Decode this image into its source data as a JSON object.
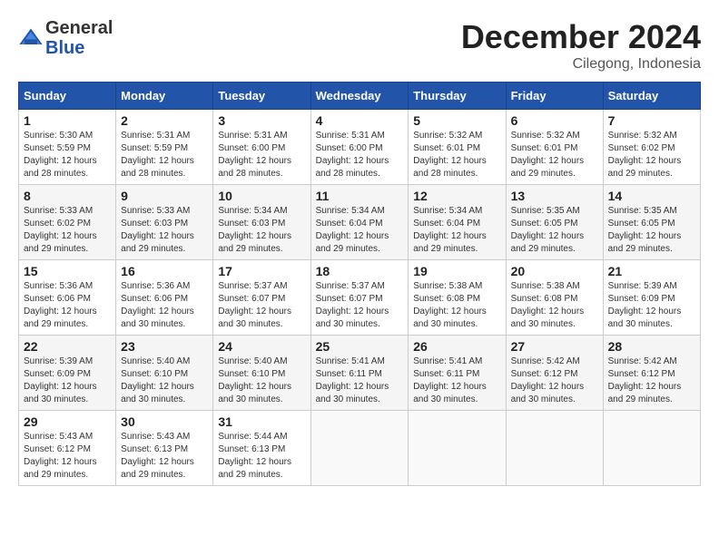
{
  "header": {
    "logo_line1": "General",
    "logo_line2": "Blue",
    "month": "December 2024",
    "location": "Cilegong, Indonesia"
  },
  "days_of_week": [
    "Sunday",
    "Monday",
    "Tuesday",
    "Wednesday",
    "Thursday",
    "Friday",
    "Saturday"
  ],
  "weeks": [
    [
      {
        "day": "1",
        "info": "Sunrise: 5:30 AM\nSunset: 5:59 PM\nDaylight: 12 hours\nand 28 minutes."
      },
      {
        "day": "2",
        "info": "Sunrise: 5:31 AM\nSunset: 5:59 PM\nDaylight: 12 hours\nand 28 minutes."
      },
      {
        "day": "3",
        "info": "Sunrise: 5:31 AM\nSunset: 6:00 PM\nDaylight: 12 hours\nand 28 minutes."
      },
      {
        "day": "4",
        "info": "Sunrise: 5:31 AM\nSunset: 6:00 PM\nDaylight: 12 hours\nand 28 minutes."
      },
      {
        "day": "5",
        "info": "Sunrise: 5:32 AM\nSunset: 6:01 PM\nDaylight: 12 hours\nand 28 minutes."
      },
      {
        "day": "6",
        "info": "Sunrise: 5:32 AM\nSunset: 6:01 PM\nDaylight: 12 hours\nand 29 minutes."
      },
      {
        "day": "7",
        "info": "Sunrise: 5:32 AM\nSunset: 6:02 PM\nDaylight: 12 hours\nand 29 minutes."
      }
    ],
    [
      {
        "day": "8",
        "info": "Sunrise: 5:33 AM\nSunset: 6:02 PM\nDaylight: 12 hours\nand 29 minutes."
      },
      {
        "day": "9",
        "info": "Sunrise: 5:33 AM\nSunset: 6:03 PM\nDaylight: 12 hours\nand 29 minutes."
      },
      {
        "day": "10",
        "info": "Sunrise: 5:34 AM\nSunset: 6:03 PM\nDaylight: 12 hours\nand 29 minutes."
      },
      {
        "day": "11",
        "info": "Sunrise: 5:34 AM\nSunset: 6:04 PM\nDaylight: 12 hours\nand 29 minutes."
      },
      {
        "day": "12",
        "info": "Sunrise: 5:34 AM\nSunset: 6:04 PM\nDaylight: 12 hours\nand 29 minutes."
      },
      {
        "day": "13",
        "info": "Sunrise: 5:35 AM\nSunset: 6:05 PM\nDaylight: 12 hours\nand 29 minutes."
      },
      {
        "day": "14",
        "info": "Sunrise: 5:35 AM\nSunset: 6:05 PM\nDaylight: 12 hours\nand 29 minutes."
      }
    ],
    [
      {
        "day": "15",
        "info": "Sunrise: 5:36 AM\nSunset: 6:06 PM\nDaylight: 12 hours\nand 29 minutes."
      },
      {
        "day": "16",
        "info": "Sunrise: 5:36 AM\nSunset: 6:06 PM\nDaylight: 12 hours\nand 30 minutes."
      },
      {
        "day": "17",
        "info": "Sunrise: 5:37 AM\nSunset: 6:07 PM\nDaylight: 12 hours\nand 30 minutes."
      },
      {
        "day": "18",
        "info": "Sunrise: 5:37 AM\nSunset: 6:07 PM\nDaylight: 12 hours\nand 30 minutes."
      },
      {
        "day": "19",
        "info": "Sunrise: 5:38 AM\nSunset: 6:08 PM\nDaylight: 12 hours\nand 30 minutes."
      },
      {
        "day": "20",
        "info": "Sunrise: 5:38 AM\nSunset: 6:08 PM\nDaylight: 12 hours\nand 30 minutes."
      },
      {
        "day": "21",
        "info": "Sunrise: 5:39 AM\nSunset: 6:09 PM\nDaylight: 12 hours\nand 30 minutes."
      }
    ],
    [
      {
        "day": "22",
        "info": "Sunrise: 5:39 AM\nSunset: 6:09 PM\nDaylight: 12 hours\nand 30 minutes."
      },
      {
        "day": "23",
        "info": "Sunrise: 5:40 AM\nSunset: 6:10 PM\nDaylight: 12 hours\nand 30 minutes."
      },
      {
        "day": "24",
        "info": "Sunrise: 5:40 AM\nSunset: 6:10 PM\nDaylight: 12 hours\nand 30 minutes."
      },
      {
        "day": "25",
        "info": "Sunrise: 5:41 AM\nSunset: 6:11 PM\nDaylight: 12 hours\nand 30 minutes."
      },
      {
        "day": "26",
        "info": "Sunrise: 5:41 AM\nSunset: 6:11 PM\nDaylight: 12 hours\nand 30 minutes."
      },
      {
        "day": "27",
        "info": "Sunrise: 5:42 AM\nSunset: 6:12 PM\nDaylight: 12 hours\nand 30 minutes."
      },
      {
        "day": "28",
        "info": "Sunrise: 5:42 AM\nSunset: 6:12 PM\nDaylight: 12 hours\nand 29 minutes."
      }
    ],
    [
      {
        "day": "29",
        "info": "Sunrise: 5:43 AM\nSunset: 6:12 PM\nDaylight: 12 hours\nand 29 minutes."
      },
      {
        "day": "30",
        "info": "Sunrise: 5:43 AM\nSunset: 6:13 PM\nDaylight: 12 hours\nand 29 minutes."
      },
      {
        "day": "31",
        "info": "Sunrise: 5:44 AM\nSunset: 6:13 PM\nDaylight: 12 hours\nand 29 minutes."
      },
      {
        "day": "",
        "info": ""
      },
      {
        "day": "",
        "info": ""
      },
      {
        "day": "",
        "info": ""
      },
      {
        "day": "",
        "info": ""
      }
    ]
  ]
}
